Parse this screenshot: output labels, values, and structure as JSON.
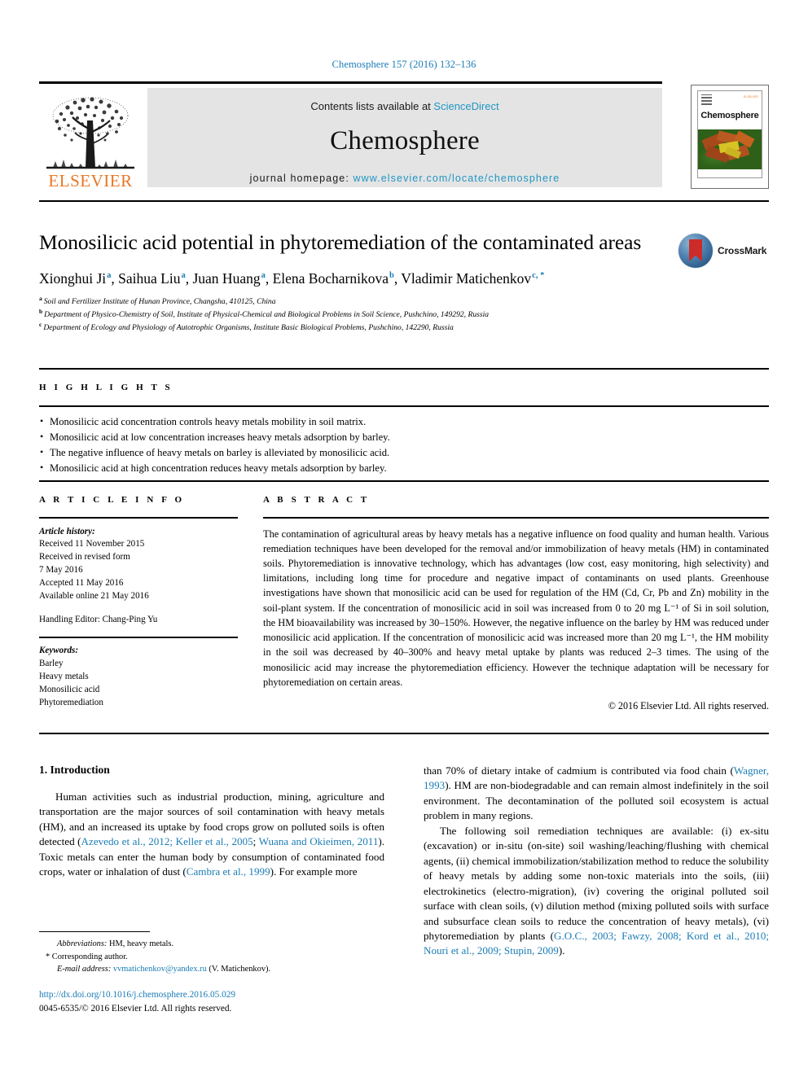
{
  "running_head": "Chemosphere 157 (2016) 132–136",
  "masthead": {
    "publisher_logo_name": "elsevier-tree-logo",
    "publisher_wordmark": "ELSEVIER",
    "contents_prefix": "Contents lists available at ",
    "contents_link": "ScienceDirect",
    "journal_name": "Chemosphere",
    "homepage_prefix": "journal homepage: ",
    "homepage_url": "www.elsevier.com/locate/chemosphere",
    "cover_title": "Chemosphere",
    "cover_brand": "ELSEVIER"
  },
  "article": {
    "title": "Monosilicic acid potential in phytoremediation of the contaminated areas",
    "crossmark_label": "CrossMark",
    "authors": [
      {
        "name": "Xionghui Ji",
        "sup": "a"
      },
      {
        "name": "Saihua Liu",
        "sup": "a"
      },
      {
        "name": "Juan Huang",
        "sup": "a"
      },
      {
        "name": "Elena Bocharnikova",
        "sup": "b"
      },
      {
        "name": "Vladimir Matichenkov",
        "sup": "c, *"
      }
    ],
    "affiliations": [
      {
        "marker": "a",
        "text": "Soil and Fertilizer Institute of Hunan Province, Changsha, 410125, China"
      },
      {
        "marker": "b",
        "text": "Department of Physico-Chemistry of Soil, Institute of Physical-Chemical and Biological Problems in Soil Science, Pushchino, 149292, Russia"
      },
      {
        "marker": "c",
        "text": "Department of Ecology and Physiology of Autotrophic Organisms, Institute Basic Biological Problems, Pushchino, 142290, Russia"
      }
    ]
  },
  "highlights": {
    "label": "H I G H L I G H T S",
    "items": [
      "Monosilicic acid concentration controls heavy metals mobility in soil matrix.",
      "Monosilicic acid at low concentration increases heavy metals adsorption by barley.",
      "The negative influence of heavy metals on barley is alleviated by monosilicic acid.",
      "Monosilicic acid at high concentration reduces heavy metals adsorption by barley."
    ]
  },
  "article_info": {
    "label": "A R T I C L E   I N F O",
    "history_heading": "Article history:",
    "history_lines": [
      "Received 11 November 2015",
      "Received in revised form",
      "7 May 2016",
      "Accepted 11 May 2016",
      "Available online 21 May 2016"
    ],
    "handling_editor": "Handling Editor: Chang-Ping Yu",
    "keywords_heading": "Keywords:",
    "keywords": [
      "Barley",
      "Heavy metals",
      "Monosilicic acid",
      "Phytoremediation"
    ]
  },
  "abstract": {
    "label": "A B S T R A C T",
    "text": "The contamination of agricultural areas by heavy metals has a negative influence on food quality and human health. Various remediation techniques have been developed for the removal and/or immobilization of heavy metals (HM) in contaminated soils. Phytoremediation is innovative technology, which has advantages (low cost, easy monitoring, high selectivity) and limitations, including long time for procedure and negative impact of contaminants on used plants. Greenhouse investigations have shown that monosilicic acid can be used for regulation of the HM (Cd, Cr, Pb and Zn) mobility in the soil-plant system. If the concentration of monosilicic acid in soil was increased from 0 to 20 mg L⁻¹ of Si in soil solution, the HM bioavailability was increased by 30–150%. However, the negative influence on the barley by HM was reduced under monosilicic acid application. If the concentration of monosilicic acid was increased more than 20 mg L⁻¹, the HM mobility in the soil was decreased by 40–300% and heavy metal uptake by plants was reduced 2–3 times. The using of the monosilicic acid may increase the phytoremediation efficiency. However the technique adaptation will be necessary for phytoremediation on certain areas.",
    "copyright": "© 2016 Elsevier Ltd. All rights reserved."
  },
  "body": {
    "section_heading": "1. Introduction",
    "left_paragraphs": [
      "Human activities such as industrial production, mining, agriculture and transportation are the major sources of soil contamination with heavy metals (HM), and an increased its uptake by food crops grow on polluted soils is often detected (Azevedo et al., 2012; Keller et al., 2005; Wuana and Okieimen, 2011). Toxic metals can enter the human body by consumption of contaminated food crops, water or inhalation of dust (Cambra et al., 1999). For example more"
    ],
    "right_paragraphs": [
      "than 70% of dietary intake of cadmium is contributed via food chain (Wagner, 1993). HM are non-biodegradable and can remain almost indefinitely in the soil environment. The decontamination of the polluted soil ecosystem is actual problem in many regions.",
      "The following soil remediation techniques are available: (i) ex-situ (excavation) or in-situ (on-site) soil washing/leaching/flushing with chemical agents, (ii) chemical immobilization/stabilization method to reduce the solubility of heavy metals by adding some non-toxic materials into the soils, (iii) electrokinetics (electro-migration), (iv) covering the original polluted soil surface with clean soils, (v) dilution method (mixing polluted soils with surface and subsurface clean soils to reduce the concentration of heavy metals), (vi) phytoremediation by plants (G.O.C., 2003; Fawzy, 2008; Kord et al., 2010; Nouri et al., 2009; Stupin, 2009)."
    ],
    "inline_refs_left": [
      "Azevedo et al., 2012;",
      "Keller et al., 2005",
      "Wuana and Okieimen, 2011",
      "Cambra et al., 1999"
    ],
    "inline_refs_right": [
      "Wagner, 1993",
      "G.O.C., 2003; Fawzy, 2008; Kord et al., 2010; Nouri et al., 2009; Stupin, 2009"
    ]
  },
  "footnotes": {
    "abbreviations_label": "Abbreviations:",
    "abbreviations_text": " HM, heavy metals.",
    "corresponding": "Corresponding author.",
    "email_label": "E-mail address:",
    "email": "vvmatichenkov@yandex.ru",
    "email_suffix": " (V. Matichenkov)."
  },
  "footer": {
    "doi": "http://dx.doi.org/10.1016/j.chemosphere.2016.05.029",
    "issn_line": "0045-6535/© 2016 Elsevier Ltd. All rights reserved."
  },
  "colors": {
    "link_blue": "#1a7cb5",
    "sciencedirect_blue": "#2196c4",
    "elsevier_orange": "#E87722",
    "band_gray": "#e4e4e4",
    "crossmark_red": "#cc2b28"
  }
}
